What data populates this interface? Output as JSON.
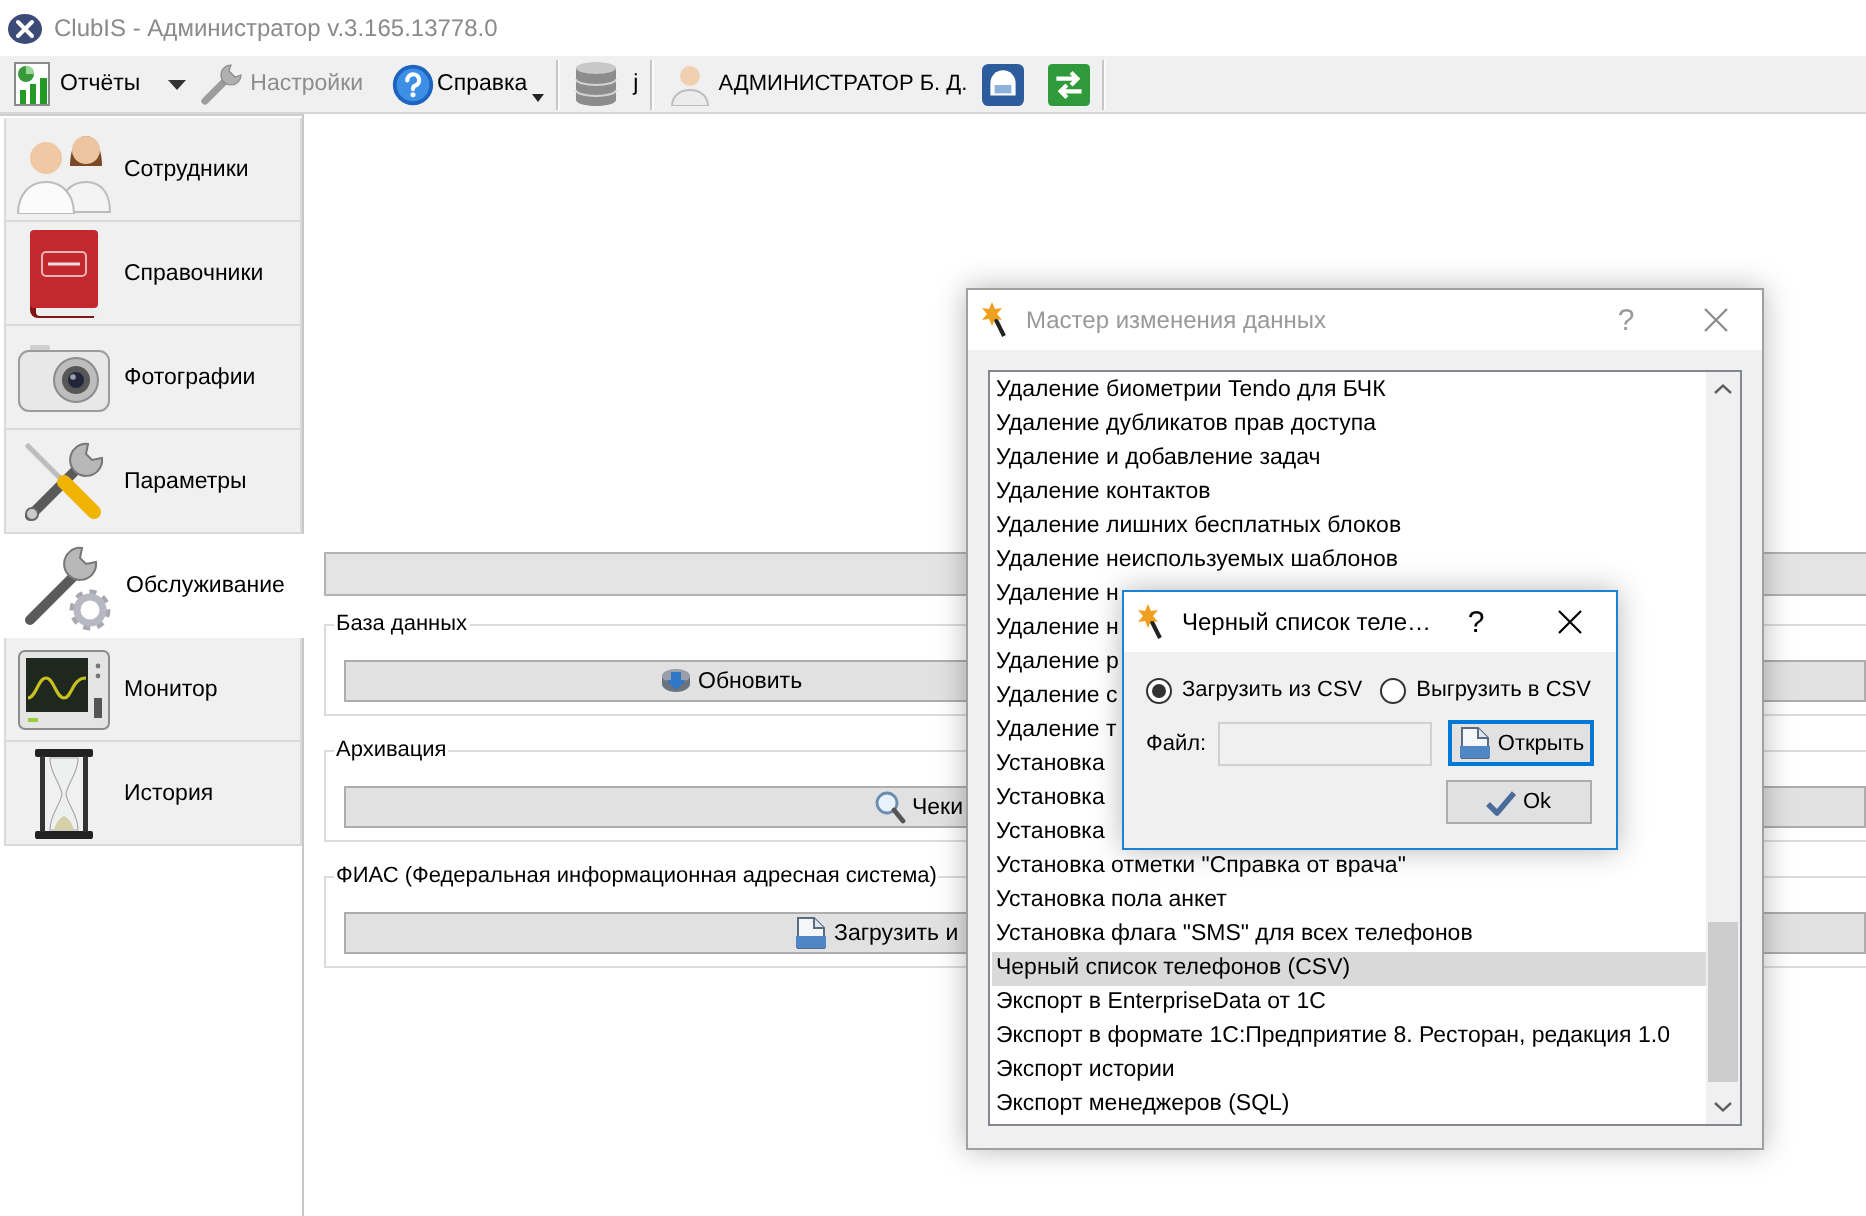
{
  "window": {
    "title": "ClubIS - Администратор v.3.165.13778.0",
    "active": false
  },
  "toolbar": [
    {
      "kind": "button",
      "label": "Отчёты",
      "disabled": false
    },
    {
      "kind": "arrow"
    },
    {
      "kind": "button",
      "label": "Настройки",
      "disabled": true
    },
    {
      "kind": "menu",
      "label": "Справка",
      "disabled": false
    },
    {
      "kind": "separator"
    },
    {
      "kind": "button",
      "label": "j",
      "disabled": false
    },
    {
      "kind": "separator"
    },
    {
      "kind": "user",
      "label": "АДМИНИСТРАТОР Б. Д."
    },
    {
      "kind": "icon_button"
    },
    {
      "kind": "icon_button"
    },
    {
      "kind": "separator"
    }
  ],
  "sidebar": [
    {
      "label": "Сотрудники",
      "selected": false
    },
    {
      "label": "Справочники",
      "selected": false
    },
    {
      "label": "Фотографии",
      "selected": false
    },
    {
      "label": "Параметры",
      "selected": false
    },
    {
      "label": "Обслуживание",
      "selected": true
    },
    {
      "label": "Монитор",
      "selected": false
    },
    {
      "label": "История",
      "selected": false
    }
  ],
  "main": {
    "sections": [
      {
        "title": "База данных",
        "button": "Обновить"
      },
      {
        "title": "Архивация",
        "button": "Чеки"
      },
      {
        "title": "ФИАС (Федеральная информационная адресная система)",
        "button": "Загрузить и"
      }
    ]
  },
  "wizard_dialog": {
    "title": "Мастер изменения данных",
    "active": false,
    "help": "?",
    "items": [
      {
        "label": "Удаление биометрии Tendo для БЧК",
        "selected": false
      },
      {
        "label": "Удаление дубликатов прав доступа",
        "selected": false
      },
      {
        "label": "Удаление и добавление задач",
        "selected": false
      },
      {
        "label": "Удаление контактов",
        "selected": false
      },
      {
        "label": "Удаление лишних бесплатных блоков",
        "selected": false
      },
      {
        "label": "Удаление неиспользуемых шаблонов",
        "selected": false
      },
      {
        "label": "Удаление н",
        "selected": false
      },
      {
        "label": "Удаление н",
        "selected": false
      },
      {
        "label": "Удаление р",
        "selected": false
      },
      {
        "label": "Удаление с",
        "selected": false
      },
      {
        "label": "Удаление т",
        "selected": false
      },
      {
        "label": "Установка",
        "selected": false
      },
      {
        "label": "Установка",
        "selected": false
      },
      {
        "label": "Установка",
        "selected": false
      },
      {
        "label": "Установка отметки \"Справка от врача\"",
        "selected": false
      },
      {
        "label": "Установка пола анкет",
        "selected": false
      },
      {
        "label": "Установка флага \"SMS\" для всех телефонов",
        "selected": false
      },
      {
        "label": "Черный список телефонов (CSV)",
        "selected": true
      },
      {
        "label": "Экспорт в EnterpriseData от 1С",
        "selected": false
      },
      {
        "label": "Экспорт в формате 1С:Предприятие 8. Ресторан, редакция 1.0",
        "selected": false
      },
      {
        "label": "Экспорт истории",
        "selected": false
      },
      {
        "label": "Экспорт менеджеров (SQL)",
        "selected": false
      }
    ]
  },
  "blacklist_dialog": {
    "title": "Черный список теле…",
    "active": true,
    "help": "?",
    "options": [
      {
        "label": "Загрузить из CSV",
        "selected": true
      },
      {
        "label": "Выгрузить в CSV",
        "selected": false
      }
    ],
    "file_label": "Файл:",
    "buttons": [
      {
        "label": "Открыть",
        "focused": true
      },
      {
        "label": "Ok",
        "focused": false
      }
    ]
  }
}
